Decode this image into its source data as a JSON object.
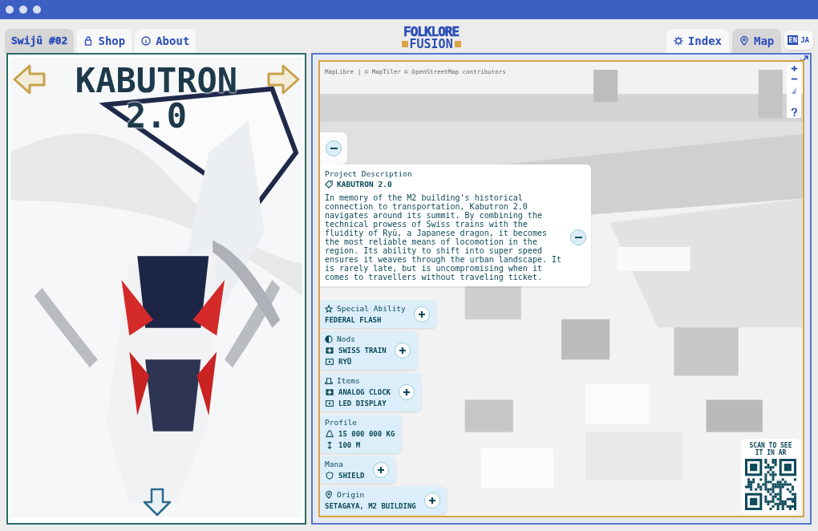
{
  "tabs_left": [
    {
      "label": "Swijū #02",
      "selected": true
    },
    {
      "label": "Shop",
      "selected": false
    },
    {
      "label": "About",
      "selected": false
    }
  ],
  "logo": {
    "top": "FOLKLORE",
    "bottom": "FUSION"
  },
  "tabs_right": [
    {
      "label": "Index",
      "selected": false
    },
    {
      "label": "Map",
      "selected": true
    }
  ],
  "languages": [
    {
      "label": "EN",
      "selected": true
    },
    {
      "label": "JA",
      "selected": false
    }
  ],
  "character": {
    "title": "KABUTRON 2.0"
  },
  "map": {
    "attribution": "MapLibre | © MapTiler © OpenStreetMap contributors"
  },
  "description": {
    "heading": "Project Description",
    "name": "KABUTRON 2.0",
    "body": "In memory of the M2 building's historical connection to transportation, Kabutron 2.0 navigates around its summit. By combining the technical prowess of Swiss trains with the fluidity of Ryū, a Japanese dragon, it becomes the most reliable means of locomotion in the region. Its ability to shift into super speed ensures it weaves through the urban landscape. It is rarely late, but is uncompromising when it comes to travellers without traveling ticket.",
    "expanded": true
  },
  "cards": [
    {
      "label": "Special Ability",
      "values": [
        "FEDERAL FLASH"
      ],
      "expandable": true
    },
    {
      "label": "Nods",
      "values": [
        "SWISS TRAIN",
        "RYŪ"
      ],
      "expandable": true
    },
    {
      "label": "Items",
      "values": [
        "ANALOG CLOCK",
        "LED DISPLAY"
      ],
      "expandable": true
    },
    {
      "label": "Profile",
      "values": [
        "15 000 000 KG",
        "100 M"
      ],
      "expandable": false
    },
    {
      "label": "Mana",
      "values": [
        "SHIELD"
      ],
      "expandable": true
    },
    {
      "label": "Origin",
      "values": [
        "SETAGAYA, M2 BUILDING"
      ],
      "expandable": true
    }
  ],
  "qr": {
    "caption": "SCAN TO SEE IT IN AR"
  }
}
